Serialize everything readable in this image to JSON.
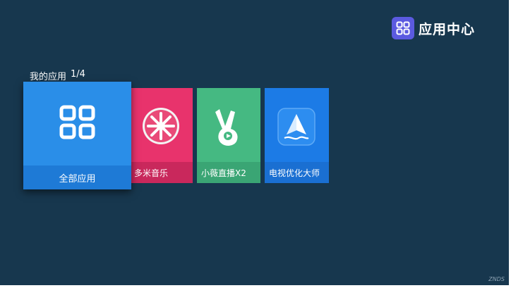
{
  "header": {
    "title": "应用中心",
    "icon": "apps-grid-icon"
  },
  "section": {
    "title": "我的应用",
    "page_indicator": "1/4"
  },
  "tiles": [
    {
      "label": "全部应用",
      "icon": "apps-grid-icon",
      "color": "#2a8ee8"
    },
    {
      "label": "多米音乐",
      "icon": "music-sun-icon",
      "color": "#e8336c"
    },
    {
      "label": "小薇直播X2",
      "icon": "victory-hand-icon",
      "color": "#45b982"
    },
    {
      "label": "电视优化大师",
      "icon": "paper-plane-icon",
      "color": "#1c7be6"
    }
  ],
  "watermark": "ZNDS"
}
